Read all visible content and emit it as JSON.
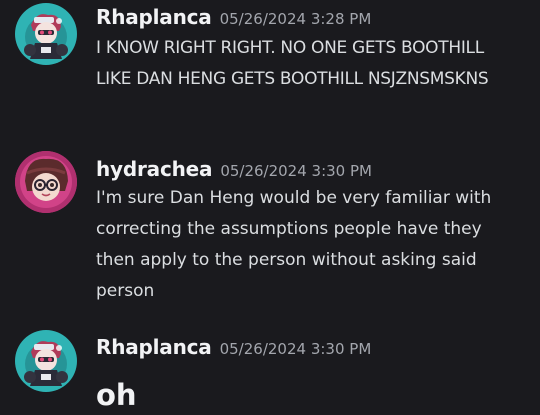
{
  "messages": [
    {
      "username": "Rhaplanca",
      "timestamp": "05/26/2024 3:28 PM",
      "text": "I KNOW RIGHT RIGHT. NO ONE GETS BOOTHILL LIKE DAN HENG GETS BOOTHILL NSJZNSMSKNS",
      "avatar_icon": "user-avatar-rhaplanca"
    },
    {
      "username": "hydrachea",
      "timestamp": "05/26/2024 3:30 PM",
      "text": "I'm sure Dan Heng would be very familiar with correcting the assumptions people have they then apply to the person without asking said person",
      "avatar_icon": "user-avatar-hydrachea"
    },
    {
      "username": "Rhaplanca",
      "timestamp": "05/26/2024 3:30 PM",
      "text": "oh",
      "avatar_icon": "user-avatar-rhaplanca"
    }
  ],
  "colors": {
    "background": "#1a1a1e",
    "username": "#f2f3f5",
    "timestamp": "#a3a6ad",
    "text": "#dbdee1",
    "avatar_teal": "#2fb3b4",
    "avatar_magenta": "#b0306f"
  }
}
